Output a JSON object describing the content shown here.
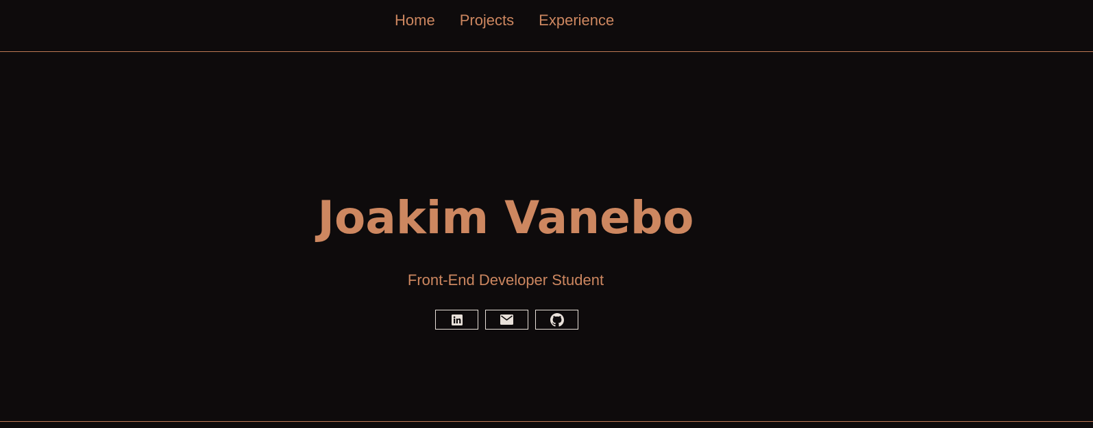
{
  "nav": {
    "items": [
      {
        "label": "Home"
      },
      {
        "label": "Projects"
      },
      {
        "label": "Experience"
      }
    ]
  },
  "hero": {
    "name": "Joakim Vanebo",
    "subtitle": "Front-End Developer Student"
  },
  "socials": [
    {
      "icon": "linkedin-icon"
    },
    {
      "icon": "email-icon"
    },
    {
      "icon": "github-icon"
    }
  ],
  "colors": {
    "background": "#0e0b0c",
    "accent": "#cd8760",
    "icon": "#e9e1da"
  }
}
